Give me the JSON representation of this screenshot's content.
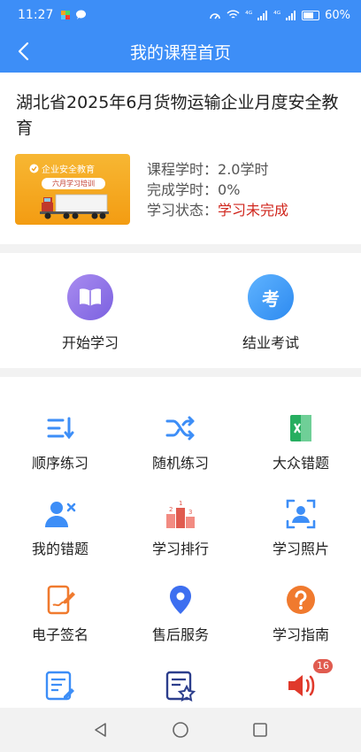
{
  "status": {
    "time": "11:27",
    "signal1": "⁴ᴳ",
    "signal2": "⁴ᴳ",
    "battery": "60%"
  },
  "header": {
    "title": "我的课程首页",
    "back_icon": "chevron-left-icon"
  },
  "course": {
    "title": "湖北省2025年6月货物运输企业月度安全教育",
    "thumb_title": "企业安全教育",
    "thumb_badge": "六月学习培训",
    "hours_label": "课程学时：",
    "hours_value": "2.0学时",
    "done_label": "完成学时：",
    "done_value": "0%",
    "state_label": "学习状态：",
    "state_value": "学习未完成",
    "warn_color": "#d0261d"
  },
  "primary_actions": [
    {
      "label": "开始学习",
      "icon": "book-icon"
    },
    {
      "label": "结业考试",
      "icon": "exam-icon",
      "glyph": "考"
    }
  ],
  "grid": [
    {
      "label": "顺序练习",
      "icon": "sequential-list-icon"
    },
    {
      "label": "随机练习",
      "icon": "shuffle-icon"
    },
    {
      "label": "大众错题",
      "icon": "excel-icon"
    },
    {
      "label": "我的错题",
      "icon": "user-x-icon"
    },
    {
      "label": "学习排行",
      "icon": "podium-icon"
    },
    {
      "label": "学习照片",
      "icon": "face-scan-icon"
    },
    {
      "label": "电子签名",
      "icon": "tablet-pen-icon"
    },
    {
      "label": "售后服务",
      "icon": "location-pin-icon"
    },
    {
      "label": "学习指南",
      "icon": "question-icon"
    },
    {
      "label": "",
      "icon": "document-edit-icon"
    },
    {
      "label": "",
      "icon": "document-star-icon"
    },
    {
      "label": "",
      "icon": "speaker-icon",
      "badge": "16"
    }
  ],
  "colors": {
    "brand_blue": "#3d8ef7",
    "accent_orange": "#f07a2e",
    "accent_green": "#27ae60"
  }
}
